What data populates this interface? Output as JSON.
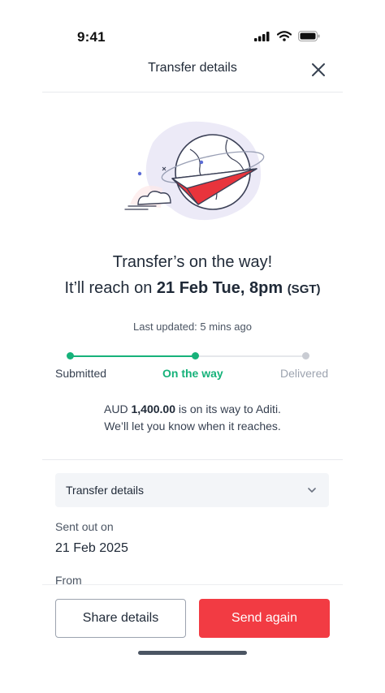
{
  "status_bar": {
    "time": "9:41"
  },
  "header": {
    "title": "Transfer details"
  },
  "headline": "Transfer’s on the way!",
  "reach": {
    "prefix": "It’ll reach on",
    "date": "21 Feb Tue, 8pm",
    "timezone": "(SGT)"
  },
  "last_updated": "Last updated: 5 mins ago",
  "progress": {
    "steps": [
      {
        "label": "Submitted",
        "state": "done"
      },
      {
        "label": "On the way",
        "state": "current"
      },
      {
        "label": "Delivered",
        "state": "pending"
      }
    ]
  },
  "message": {
    "currency": "AUD",
    "amount": "1,400.00",
    "rest_line1": "is on its way to Aditi.",
    "line2": "We’ll let you know when it reaches."
  },
  "accordion": {
    "title": "Transfer details"
  },
  "details": {
    "sent_out_label": "Sent out on",
    "sent_out_value": "21 Feb 2025",
    "from_label": "From"
  },
  "actions": {
    "share_label": "Share details",
    "send_again_label": "Send again"
  },
  "colors": {
    "accent_red": "#f23b43",
    "progress_green": "#16b27a",
    "pending_gray": "#9ca3af"
  },
  "icons": [
    "signal-icon",
    "wifi-icon",
    "battery-icon",
    "close-icon",
    "paper-plane-globe-illustration",
    "chevron-down-icon"
  ]
}
